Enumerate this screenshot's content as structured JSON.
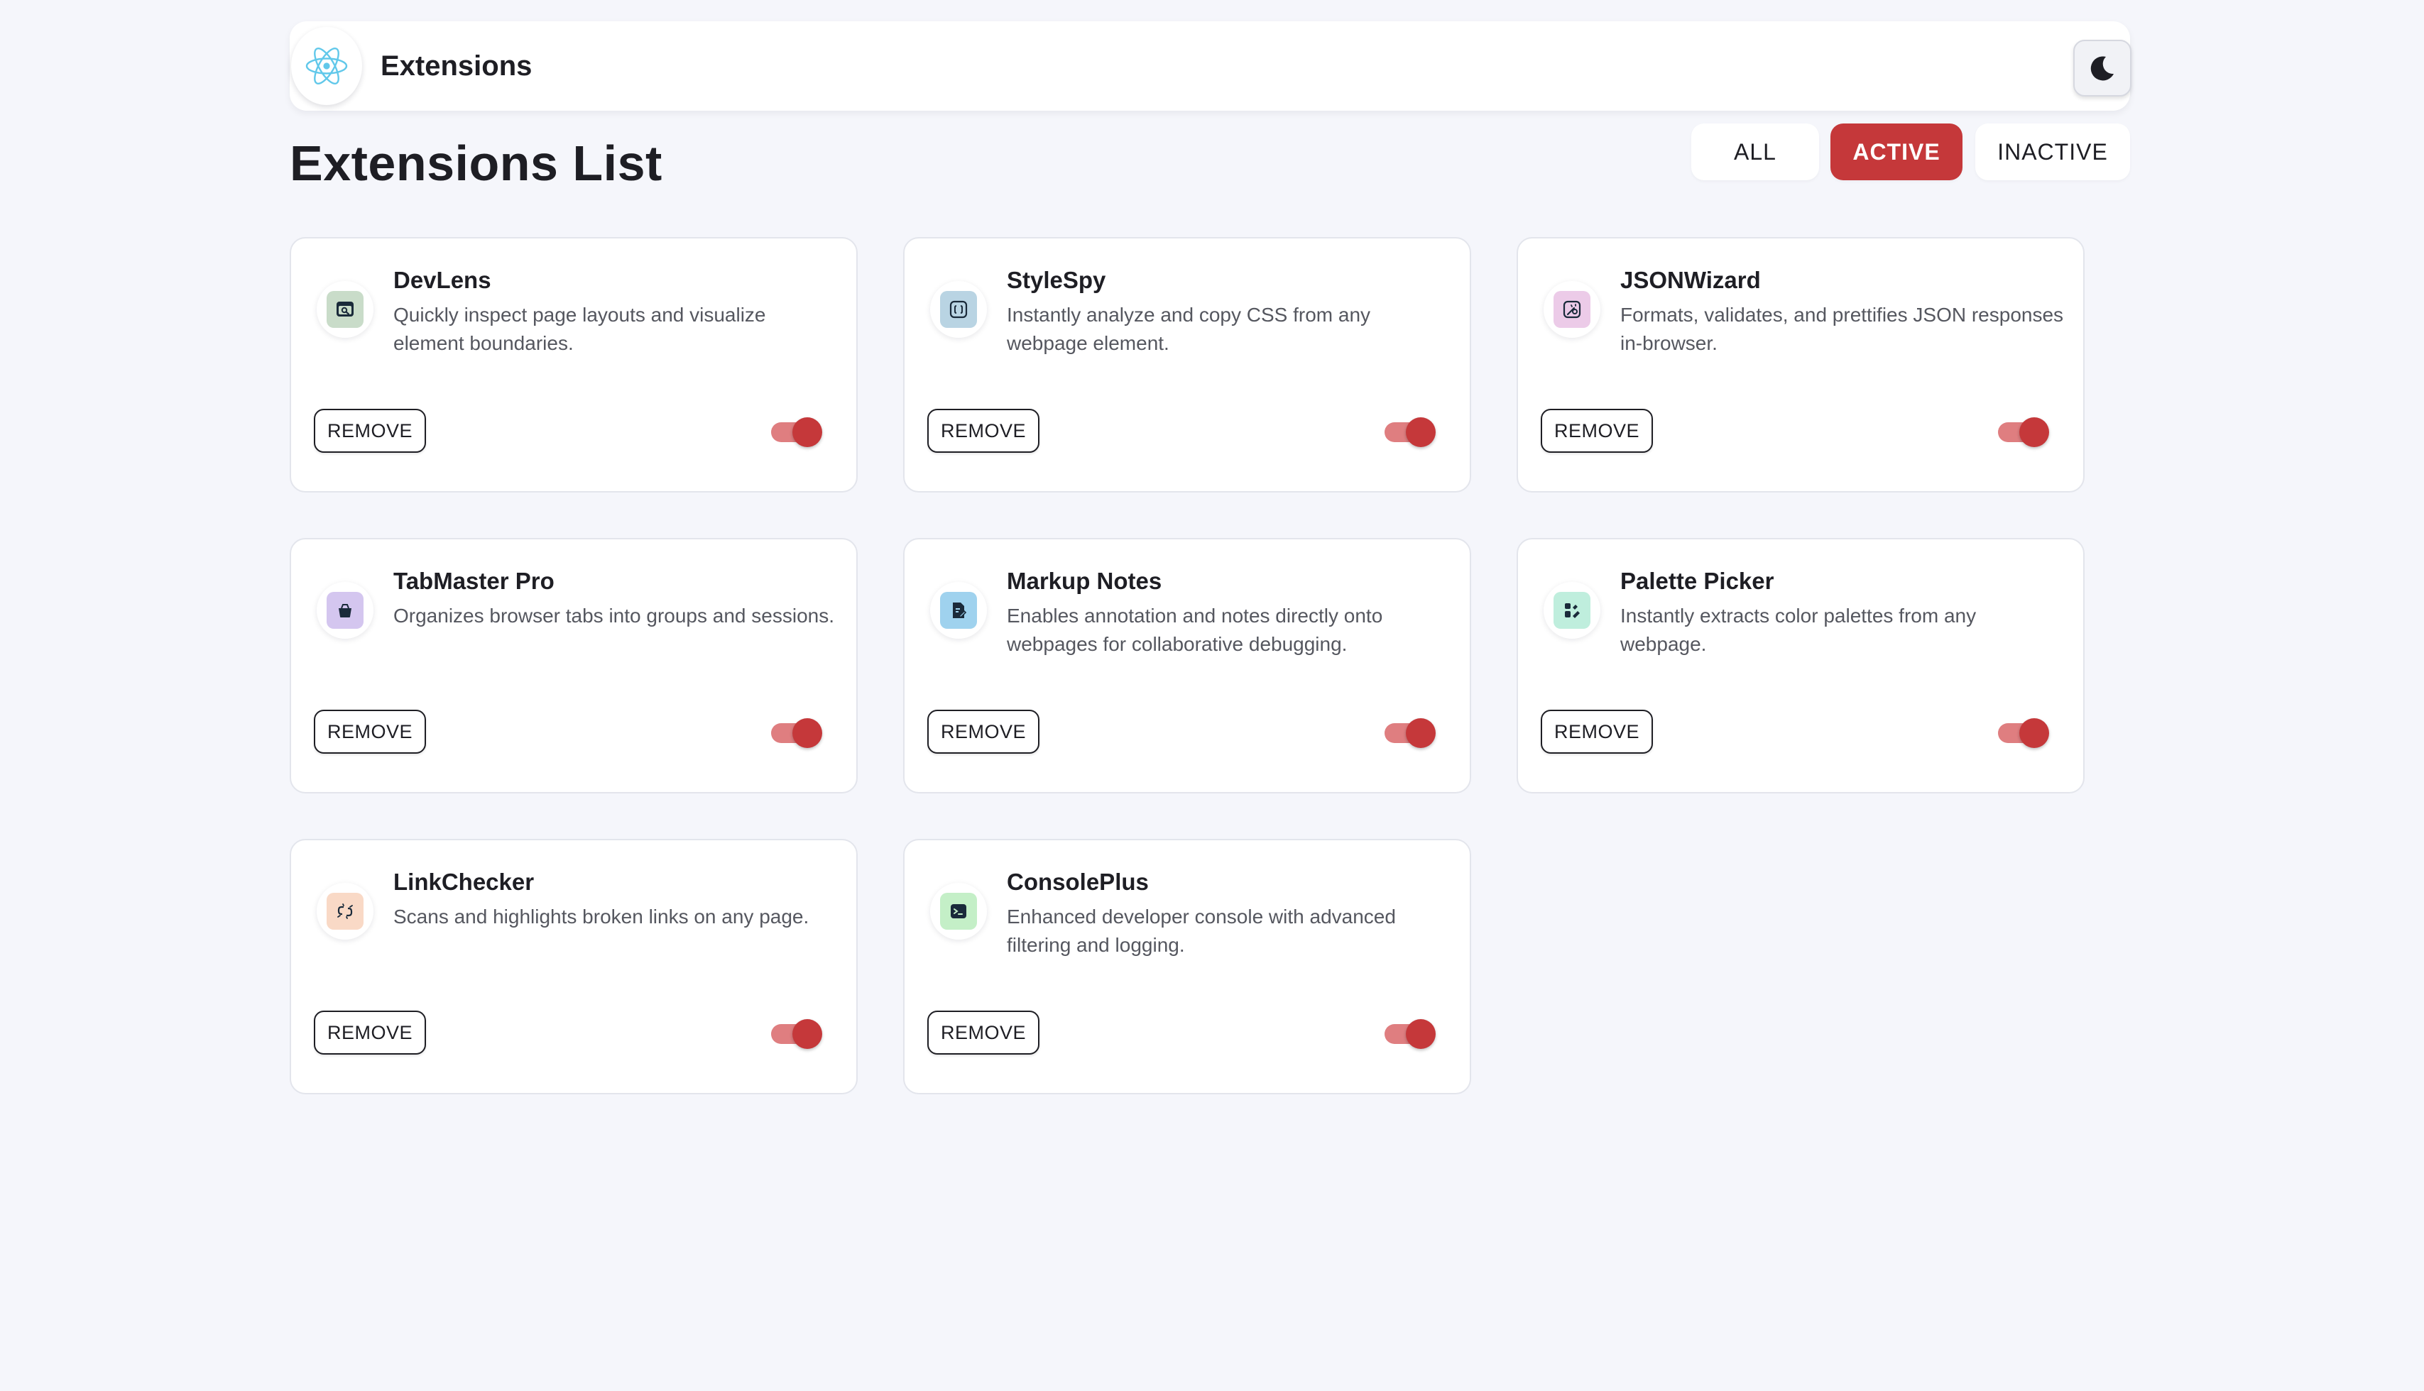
{
  "app": {
    "title": "Extensions",
    "logo_icon": "react-atom-icon",
    "theme_icon": "moon-icon"
  },
  "page": {
    "title": "Extensions List"
  },
  "filters": {
    "all": "ALL",
    "active": "ACTIVE",
    "inactive": "INACTIVE",
    "selected": "ACTIVE"
  },
  "colors": {
    "accent": "#c5383a",
    "toggle_track": "#df7e80",
    "background": "#f5f6fb"
  },
  "extensions": [
    {
      "name": "DevLens",
      "description": "Quickly inspect page layouts and visualize element boundaries.",
      "icon": "inspect-browser-icon",
      "icon_bg": "#c9dcc9",
      "remove_label": "REMOVE",
      "active": true
    },
    {
      "name": "StyleSpy",
      "description": "Instantly analyze and copy CSS from any webpage element.",
      "icon": "css-braces-icon",
      "icon_bg": "#b9d4e3",
      "remove_label": "REMOVE",
      "active": true
    },
    {
      "name": "JSONWizard",
      "description": "Formats, validates, and prettifies JSON responses in-browser.",
      "icon": "json-magic-icon",
      "icon_bg": "#eccbe8",
      "remove_label": "REMOVE",
      "active": true
    },
    {
      "name": "TabMaster Pro",
      "description": "Organizes browser tabs into groups and sessions.",
      "icon": "tab-basket-icon",
      "icon_bg": "#d4c6ef",
      "remove_label": "REMOVE",
      "active": true
    },
    {
      "name": "Markup Notes",
      "description": "Enables annotation and notes directly onto webpages for collaborative debugging.",
      "icon": "note-pen-icon",
      "icon_bg": "#9fd2ee",
      "remove_label": "REMOVE",
      "active": true
    },
    {
      "name": "Palette Picker",
      "description": "Instantly extracts color palettes from any webpage.",
      "icon": "palette-icon",
      "icon_bg": "#bfeedd",
      "remove_label": "REMOVE",
      "active": true
    },
    {
      "name": "LinkChecker",
      "description": "Scans and highlights broken links on any page.",
      "icon": "broken-link-icon",
      "icon_bg": "#f9d9c6",
      "remove_label": "REMOVE",
      "active": true
    },
    {
      "name": "ConsolePlus",
      "description": "Enhanced developer console with advanced filtering and logging.",
      "icon": "terminal-icon",
      "icon_bg": "#c4efc7",
      "remove_label": "REMOVE",
      "active": true
    }
  ]
}
